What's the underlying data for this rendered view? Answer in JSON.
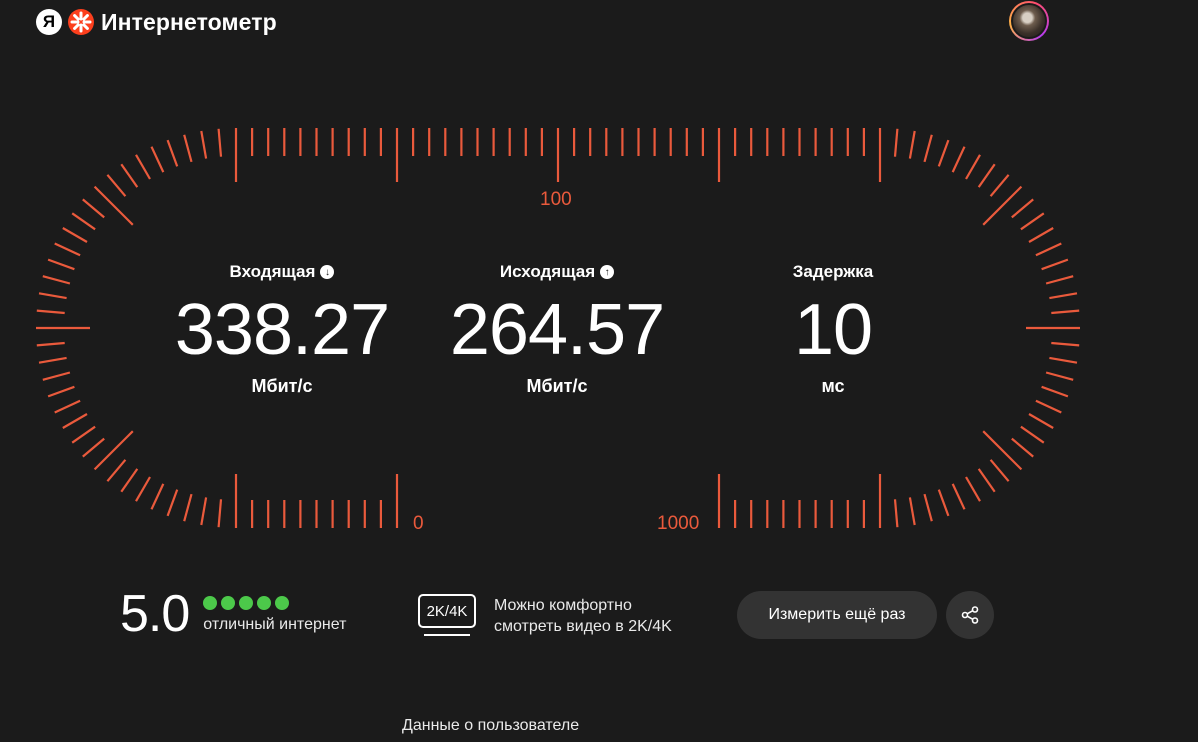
{
  "header": {
    "logo_letter": "Я",
    "title": "Интернетометр"
  },
  "gauge": {
    "labels": {
      "top": "100",
      "bottom_left": "0",
      "bottom_right": "1000"
    },
    "color": "#ea5a3c"
  },
  "metrics": {
    "download": {
      "label": "Входящая",
      "value": "338.27",
      "unit": "Мбит/с",
      "icon": "arrow-down-icon"
    },
    "upload": {
      "label": "Исходящая",
      "value": "264.57",
      "unit": "Мбит/с",
      "icon": "arrow-up-icon"
    },
    "latency": {
      "label": "Задержка",
      "value": "10",
      "unit": "мс"
    }
  },
  "rating": {
    "score": "5.0",
    "dots": 5,
    "text": "отличный интернет",
    "dot_color": "#4cc94a"
  },
  "quality": {
    "badge": "2K/4K",
    "text_line1": "Можно комфортно",
    "text_line2": "смотреть видео в 2K/4K"
  },
  "actions": {
    "retest_label": "Измерить ещё раз",
    "share_icon": "share-icon"
  },
  "footer": {
    "link": "Данные о пользователе"
  }
}
